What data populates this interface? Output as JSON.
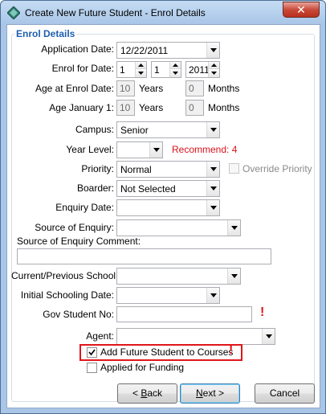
{
  "window": {
    "title": "Create New Future Student - Enrol Details",
    "close_glyph": "✕"
  },
  "group": {
    "title": "Enrol Details"
  },
  "fields": {
    "application_date": {
      "label": "Application Date:",
      "value": "12/22/2011"
    },
    "enrol_for_date": {
      "label": "Enrol for Date:",
      "day": "1",
      "month": "1",
      "year": "2011"
    },
    "age_at_enrol": {
      "label": "Age at Enrol Date:",
      "years": "10",
      "years_label": "Years",
      "months": "0",
      "months_label": "Months"
    },
    "age_january": {
      "label": "Age January 1:",
      "years": "10",
      "years_label": "Years",
      "months": "0",
      "months_label": "Months"
    },
    "campus": {
      "label": "Campus:",
      "value": "Senior"
    },
    "year_level": {
      "label": "Year Level:",
      "value": "",
      "recommend": "Recommend: 4"
    },
    "priority": {
      "label": "Priority:",
      "value": "Normal",
      "override_label": "Override Priority"
    },
    "boarder": {
      "label": "Boarder:",
      "value": "Not Selected"
    },
    "enquiry_date": {
      "label": "Enquiry Date:",
      "value": ""
    },
    "source_of_enquiry": {
      "label": "Source of Enquiry:",
      "value": ""
    },
    "source_comment": {
      "label": "Source of Enquiry Comment:",
      "value": ""
    },
    "current_school": {
      "label": "Current/Previous School:",
      "value": ""
    },
    "initial_schooling_date": {
      "label": "Initial Schooling Date:",
      "value": ""
    },
    "gov_student_no": {
      "label": "Gov Student No:",
      "value": "",
      "warning": "!"
    },
    "agent": {
      "label": "Agent:",
      "value": ""
    },
    "add_to_courses": {
      "label": "Add Future Student to Courses",
      "checked": true,
      "warning": "!"
    },
    "applied_for_funding": {
      "label": "Applied for Funding",
      "checked": false
    }
  },
  "buttons": {
    "back": {
      "label_pre": "< ",
      "label_ul": "B",
      "label_post": "ack"
    },
    "next": {
      "label_ul": "N",
      "label_post": "ext >"
    },
    "cancel": {
      "label": "Cancel"
    }
  },
  "colors": {
    "accent": "#1f5fb0",
    "warning": "#e0161a",
    "recommend": "#d8121c"
  }
}
